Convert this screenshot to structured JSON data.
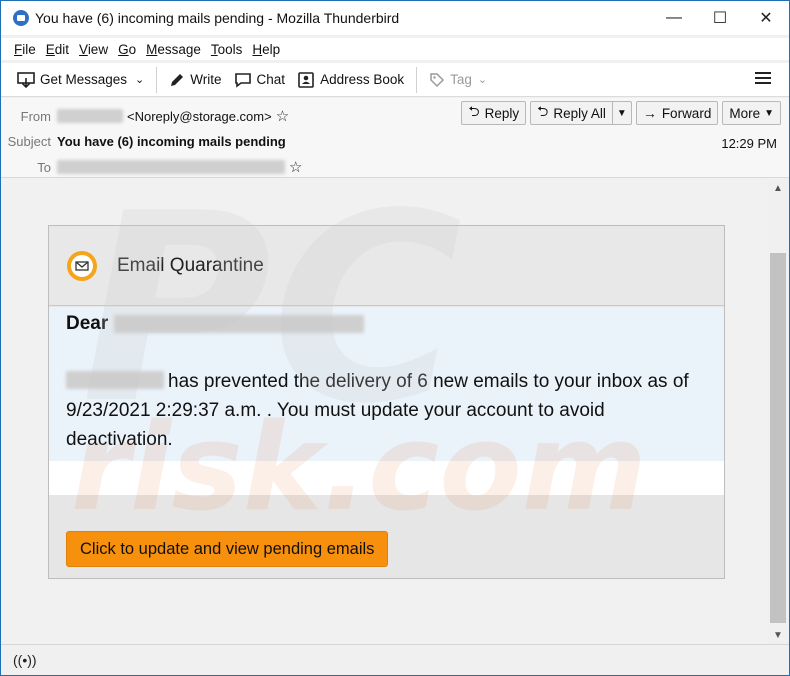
{
  "window": {
    "title": "You have (6) incoming mails pending - Mozilla Thunderbird",
    "minimize": "—",
    "maximize": "☐",
    "close": "✕"
  },
  "menu": [
    {
      "u": "F",
      "rest": "ile"
    },
    {
      "u": "E",
      "rest": "dit"
    },
    {
      "u": "V",
      "rest": "iew"
    },
    {
      "u": "G",
      "rest": "o"
    },
    {
      "u": "M",
      "rest": "essage"
    },
    {
      "u": "T",
      "rest": "ools"
    },
    {
      "u": "H",
      "rest": "elp"
    }
  ],
  "toolbar": {
    "get_messages": "Get Messages",
    "write": "Write",
    "chat": "Chat",
    "address_book": "Address Book",
    "tag": "Tag"
  },
  "header": {
    "from_label": "From",
    "from_address": "<Noreply@storage.com>",
    "subject_label": "Subject",
    "subject": "You have (6) incoming mails pending",
    "to_label": "To",
    "time": "12:29 PM",
    "buttons": {
      "reply": "Reply",
      "reply_all": "Reply All",
      "forward": "Forward",
      "more": "More"
    }
  },
  "email": {
    "card_title": "Email Quarantine",
    "dear": "Dear",
    "message": "has prevented the delivery of 6 new emails to your inbox as of 9/23/2021 2:29:37 a.m. . You must update your account to avoid deactivation.",
    "cta": "Click to update  and view pending emails"
  },
  "watermark": {
    "brand": "PC",
    "site": "risk.com"
  },
  "icons": {
    "app": "thunderbird-icon",
    "status": "wireless-status-icon"
  }
}
